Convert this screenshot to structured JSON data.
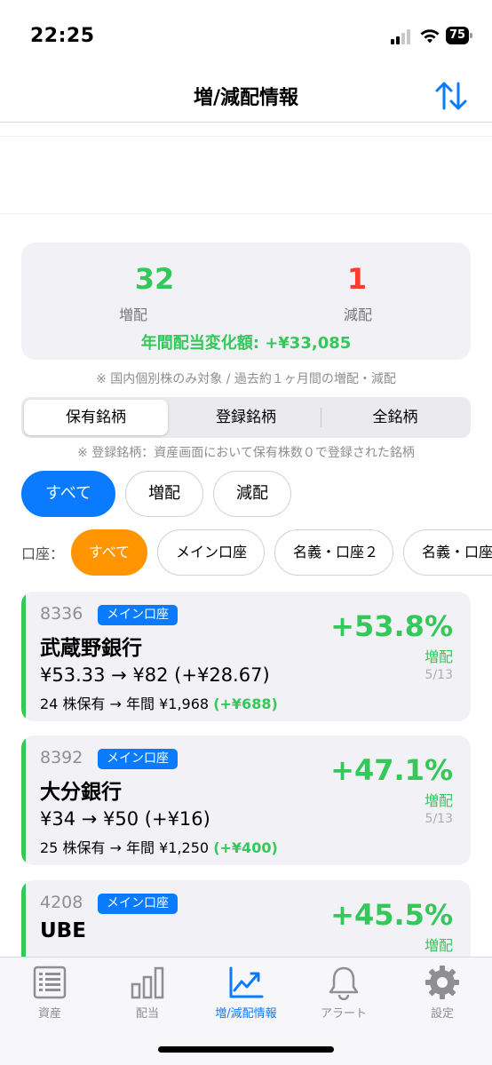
{
  "status_bar": {
    "time": "22:25",
    "battery": "75"
  },
  "header": {
    "title": "増/減配情報"
  },
  "summary": {
    "increase_count": "32",
    "increase_label": "増配",
    "decrease_count": "1",
    "decrease_label": "減配",
    "annual_change": "年間配当変化額: +¥33,085",
    "increase_color": "#34c759",
    "decrease_color": "#ff3b30"
  },
  "notes": {
    "scope": "※ 国内個別株のみ対象 / 過去約１ヶ月間の増配・減配",
    "registered": "※ 登録銘柄：資産画面において保有株数０で登録された銘柄"
  },
  "segments": [
    "保有銘柄",
    "登録銘柄",
    "全銘柄"
  ],
  "type_filters": [
    "すべて",
    "増配",
    "減配"
  ],
  "account_filter": {
    "label": "口座：",
    "options": [
      "すべて",
      "メイン口座",
      "名義・口座２",
      "名義・口座"
    ]
  },
  "stocks": [
    {
      "code": "8336",
      "account": "メイン口座",
      "name": "武蔵野銀行",
      "price_change": "¥53.33 → ¥82 (+¥28.67)",
      "holding": "24 株保有 → 年間 ¥1,968",
      "holding_gain": "(+¥688)",
      "percent": "+53.8%",
      "type": "増配",
      "date": "5/13"
    },
    {
      "code": "8392",
      "account": "メイン口座",
      "name": "大分銀行",
      "price_change": "¥34 → ¥50 (+¥16)",
      "holding": "25 株保有 → 年間 ¥1,250",
      "holding_gain": "(+¥400)",
      "percent": "+47.1%",
      "type": "増配",
      "date": "5/13"
    },
    {
      "code": "4208",
      "account": "メイン口座",
      "name": "UBE",
      "percent": "+45.5%",
      "type": "増配"
    }
  ],
  "tabs": [
    {
      "label": "資産",
      "icon": "list-icon"
    },
    {
      "label": "配当",
      "icon": "bar-chart-icon"
    },
    {
      "label": "増/減配情報",
      "icon": "trend-chart-icon",
      "active": true
    },
    {
      "label": "アラート",
      "icon": "bell-icon"
    },
    {
      "label": "設定",
      "icon": "gear-icon"
    }
  ],
  "colors": {
    "accent": "#0a7aff",
    "positive": "#34c759",
    "negative": "#ff3b30",
    "account_active": "#ff9500"
  }
}
